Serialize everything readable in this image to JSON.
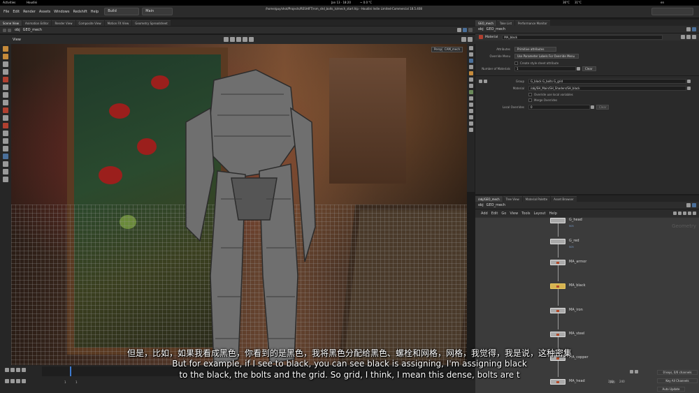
{
  "gnome": {
    "activities": "Activities",
    "app": "Houdini",
    "clock": "Jan 13 · 18:20",
    "temp": "~ 0.0 °C",
    "sys1": "36°C",
    "sys2": "31°C",
    "lang": "en"
  },
  "window": {
    "title": "/home/guy/shot/Projects/RESHIFT/rsm_shd_bolts_ls/mech_start.hip - Houdini Indie Limited-Commercial 18.5.408"
  },
  "menu": {
    "items": [
      "File",
      "Edit",
      "Render",
      "Assets",
      "Windows",
      "Redshift",
      "Help"
    ],
    "desktop": "Build",
    "mode": "Main"
  },
  "left_tabs": [
    "Scene View",
    "Animation Editor",
    "Render View",
    "Composite View",
    "Motion FX View",
    "Geometry Spreadsheet"
  ],
  "left_path": {
    "root": "obj",
    "node": "GEO_mech"
  },
  "viewport": {
    "label": "View",
    "persp": "Persp",
    "cam": "CAM_mech"
  },
  "right_tabs_top": [
    "GEO_mech",
    "Take List",
    "Performance Monitor"
  ],
  "params": {
    "path_root": "obj",
    "path_node": "GEO_mech",
    "node_type": "Material",
    "node_name": "MA_black",
    "attributes_label": "Attributes",
    "attributes_value": "Primitive attributes",
    "override_menu_label": "Override Menu",
    "override_menu_value": "Use Parameter Labels For Override Menu",
    "create_style_label": "Create style sheet attribute",
    "num_materials_label": "Number of Materials",
    "num_materials_value": "1",
    "clear_label": "Clear",
    "group_label": "Group",
    "group_value": "G_black G_bolts G_grid",
    "material_label": "Material",
    "material_value": "/obj/SH_Main/SH_Shaders/SH_black",
    "override_local_label": "Override use local variables",
    "merge_overrides_label": "Merge Overrides",
    "local_overrides_label": "Local Overrides",
    "local_overrides_value": "0",
    "clear2_label": "Clear"
  },
  "network": {
    "tabs": [
      "/obj/GEO_mech",
      "Tree View",
      "Material Palette",
      "Asset Browser"
    ],
    "path_root": "obj",
    "path_node": "GEO_mech",
    "menu": [
      "Add",
      "Edit",
      "Go",
      "View",
      "Tools",
      "Layout",
      "Help"
    ],
    "context": "Geometry",
    "nodes": [
      {
        "name": "G_head",
        "sub": "505"
      },
      {
        "name": "G_red",
        "sub": "505"
      },
      {
        "name": "MA_armor",
        "sub": ""
      },
      {
        "name": "MA_black",
        "sub": ""
      },
      {
        "name": "MA_iron",
        "sub": ""
      },
      {
        "name": "MA_steel",
        "sub": ""
      },
      {
        "name": "MA_copper",
        "sub": ""
      },
      {
        "name": "MA_head",
        "sub": ""
      }
    ]
  },
  "timeline": {
    "frame": "1",
    "start": "1",
    "start2": "1",
    "end": "240",
    "end2": "240",
    "keys_label": "0 keys, 0/0 channels",
    "key_all_label": "Key All Channels",
    "auto_update": "Auto Update"
  },
  "subtitles": {
    "zh": "但是，比如，如果我看成黑色，你看到的是黑色，我将黑色分配给黑色、螺栓和网格，网格，我觉得，我是说，这种密集",
    "en1": "But for example, if I see to black, you can see black is assigning, I'm assigning black",
    "en2": "to the black, the bolts and the grid. So grid, I think, I mean this dense, bolts are t"
  }
}
